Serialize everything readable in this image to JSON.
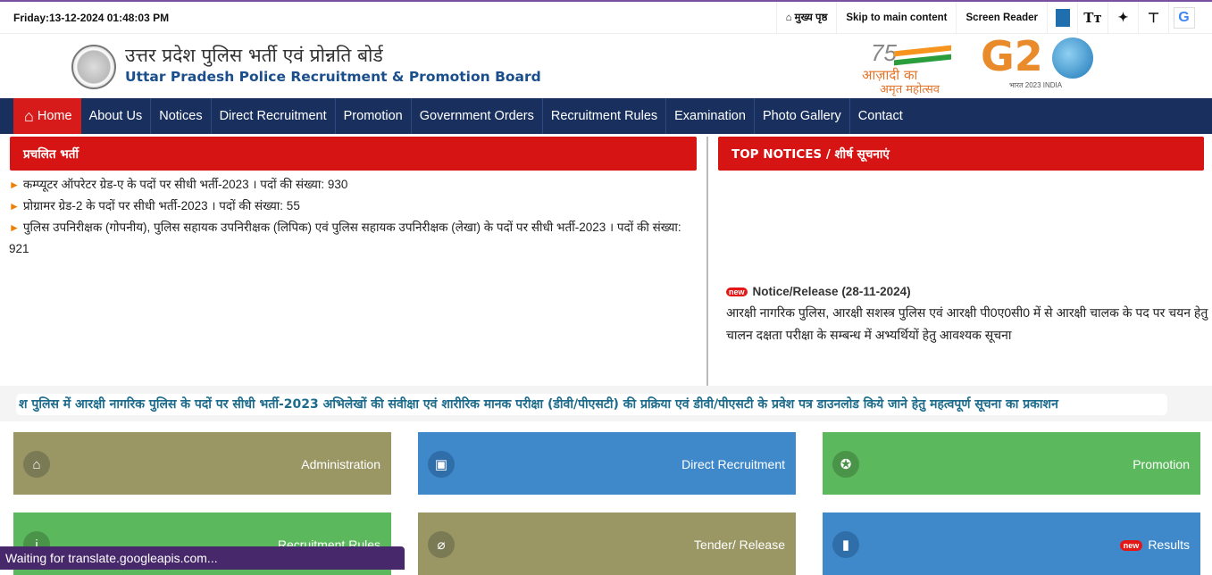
{
  "topbar": {
    "datetime": "Friday:13-12-2024 01:48:03 PM",
    "links": [
      {
        "label": "मुख्य पृष्ठ",
        "icon": "home-icon"
      },
      {
        "label": "Skip to main content"
      },
      {
        "label": "Screen Reader"
      }
    ],
    "icons": [
      "contrast-icon",
      "text-size-icon",
      "social-icon",
      "sitemap-icon",
      "google-translate-icon"
    ],
    "text_size_glyph": "Tт",
    "social_glyph": "✦",
    "sitemap_glyph": "⊤",
    "google_glyph": "G"
  },
  "header": {
    "title_hi": "उत्तर प्रदेश पुलिस भर्ती एवं प्रोन्नति बोर्ड",
    "title_en": "Uttar Pradesh Police Recruitment & Promotion Board",
    "azadi": {
      "number": "75",
      "line1": "आज़ादी का",
      "line2": "अमृत महोत्सव"
    },
    "g20": {
      "g": "G2",
      "sub": "भारत 2023 INDIA"
    }
  },
  "nav": {
    "items": [
      {
        "label": "Home",
        "active": true
      },
      {
        "label": "About Us"
      },
      {
        "label": "Notices"
      },
      {
        "label": "Direct Recruitment"
      },
      {
        "label": "Promotion"
      },
      {
        "label": "Government Orders"
      },
      {
        "label": "Recruitment Rules"
      },
      {
        "label": "Examination"
      },
      {
        "label": "Photo Gallery"
      },
      {
        "label": "Contact"
      }
    ],
    "home_glyph": "⌂"
  },
  "current_recruitment": {
    "heading": "प्रचलित भर्ती",
    "arrow": "►",
    "items": [
      "कम्प्यूटर ऑपरेटर ग्रेड-ए के पदों पर सीधी भर्ती-2023 । पदों की संख्या: 930",
      "प्रोग्रामर ग्रेड-2 के पदों पर सीधी भर्ती-2023 । पदों की संख्या: 55",
      "पुलिस उपनिरीक्षक (गोपनीय), पुलिस सहायक उपनिरीक्षक (लिपिक) एवं पुलिस सहायक उपनिरीक्षक (लेखा) के पदों पर सीधी भर्ती-2023 । पदों की संख्या: 921"
    ]
  },
  "top_notices": {
    "heading": "TOP NOTICES / शीर्ष सूचनाएं",
    "badge": "new",
    "title": "Notice/Release (28-11-2024)",
    "text": "आरक्षी नागरिक पुलिस, आरक्षी सशस्त्र पुलिस एवं आरक्षी पी0ए0सी0 में से आरक्षी चालक के पद पर चयन हेतु चालन दक्षता परीक्षा के सम्बन्ध में अभ्यर्थियों हेतु आवश्यक सूचना"
  },
  "ticker": {
    "text": "श पुलिस में आरक्षी नागरिक पुलिस के पदों पर सीधी भर्ती-2023 अभिलेखों की संवीक्षा एवं शारीरिक मानक परीक्षा (डीवी/पीएसटी) की प्रक्रिया एवं डीवी/पीएसटी के प्रवेश पत्र डाउनलोड किये जाने हेतु महत्वपूर्ण सूचना का प्रकाशन"
  },
  "tiles": [
    {
      "label": "Administration",
      "icon": "home-icon",
      "glyph": "⌂",
      "color": "#9a9765"
    },
    {
      "label": "Direct Recruitment",
      "icon": "contact-book-icon",
      "glyph": "▣",
      "color": "#3f89cb"
    },
    {
      "label": "Promotion",
      "icon": "medal-icon",
      "glyph": "✪",
      "color": "#5cb85c"
    },
    {
      "label": "Recruitment Rules",
      "icon": "info-icon",
      "glyph": "i",
      "color": "#5cb85c"
    },
    {
      "label": "Tender/ Release",
      "icon": "paperclip-icon",
      "glyph": "⌀",
      "color": "#9a9765"
    },
    {
      "label": "Results",
      "icon": "bookmark-icon",
      "glyph": "▮",
      "color": "#3f89cb",
      "badge": "new"
    }
  ],
  "status_bar": {
    "text": "Waiting for translate.googleapis.com..."
  }
}
